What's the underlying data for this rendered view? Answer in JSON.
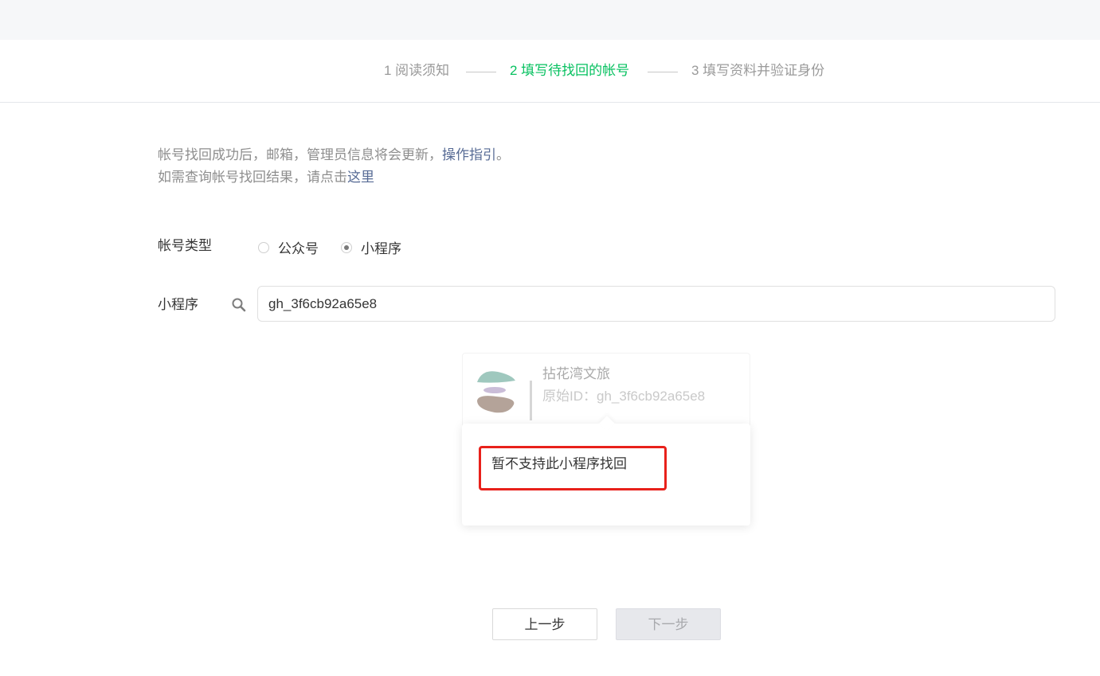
{
  "steps": [
    {
      "label": "1 阅读须知"
    },
    {
      "label": "2 填写待找回的帐号"
    },
    {
      "label": "3 填写资料并验证身份"
    }
  ],
  "notice": {
    "line1_text": "帐号找回成功后，邮箱，管理员信息将会更新，",
    "line1_link": "操作指引",
    "line1_end": "。",
    "line2_text": "如需查询帐号找回结果，请点击",
    "line2_link": "这里"
  },
  "form": {
    "account_type_label": "帐号类型",
    "options": [
      {
        "label": "公众号",
        "checked": false
      },
      {
        "label": "小程序",
        "checked": true
      }
    ],
    "search_label": "小程序",
    "search_value": "gh_3f6cb92a65e8",
    "search_icon": "search-icon"
  },
  "result": {
    "name": "拈花湾文旅",
    "id_text": "原始ID：gh_3f6cb92a65e8"
  },
  "popover": {
    "message": "暂不支持此小程序找回",
    "highlight_color": "#e8211b"
  },
  "buttons": {
    "prev": "上一步",
    "next": "下一步"
  },
  "colors": {
    "active_step": "#07c160",
    "link": "#576b95"
  }
}
